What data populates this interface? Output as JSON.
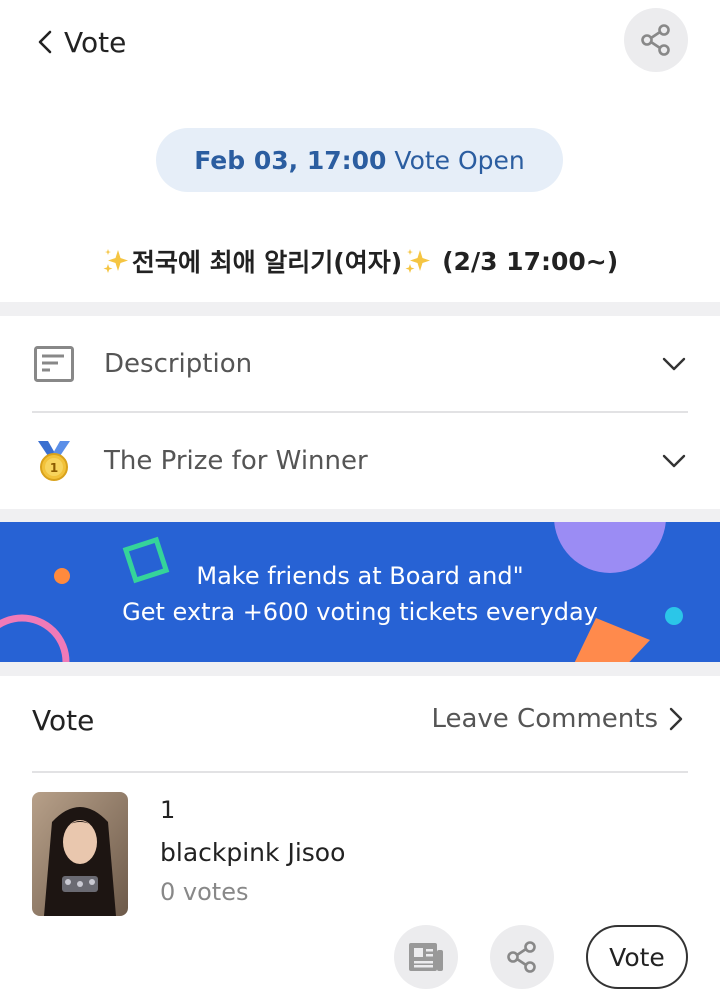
{
  "header": {
    "title": "Vote",
    "back_icon": "chevron-left-icon",
    "share_icon": "share-icon"
  },
  "open_status": {
    "date": "Feb 03, 17:00",
    "label": "Vote Open"
  },
  "vote_title": {
    "text": "전국에 최애 알리기(여자)",
    "period": "(2/3 17:00~)",
    "decoration_icon": "sparkles-icon"
  },
  "sections": [
    {
      "label": "Description",
      "icon": "document-icon"
    },
    {
      "label": "The Prize for Winner",
      "icon": "gold-medal-icon"
    }
  ],
  "banner": {
    "line1": "Make friends at Board and\"",
    "line2": "Get extra +600 voting tickets everyday"
  },
  "vote_section": {
    "title": "Vote",
    "leave_comments": "Leave Comments"
  },
  "candidates": [
    {
      "rank": "1",
      "name": "blackpink Jisoo",
      "votes": "0 votes",
      "vote_button": "Vote"
    }
  ],
  "colors": {
    "accent": "#2b5da0",
    "pill_bg": "#e6eef8",
    "banner_bg": "#2762d4",
    "separator": "#f0f0f2",
    "muted_text": "#888888"
  }
}
